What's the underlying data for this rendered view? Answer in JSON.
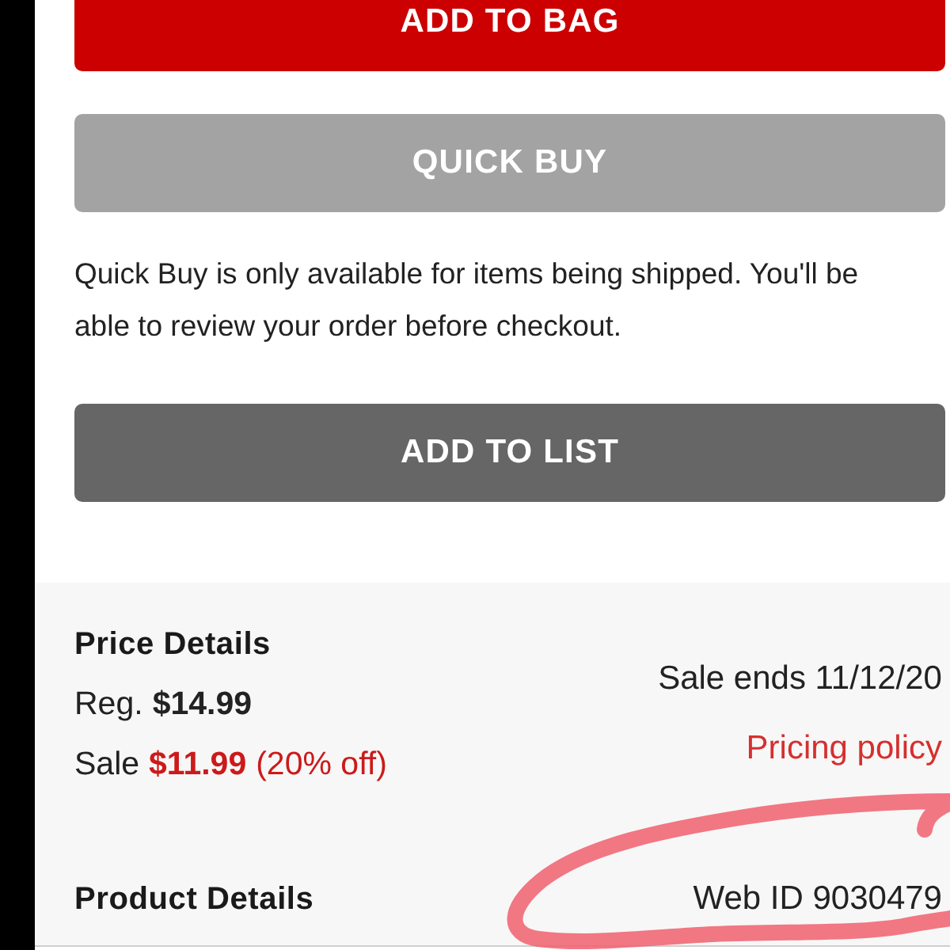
{
  "add_to_bag_button": {
    "label": "ADD TO BAG",
    "disabled": false
  },
  "quick_buy_button": {
    "label": "QUICK BUY",
    "disabled": true
  },
  "quick_buy_note": "Quick Buy is only available for items being shipped. You'll be able to review your order before checkout.",
  "add_to_list_button": {
    "label": "ADD TO LIST"
  },
  "price_details": {
    "title": "Price Details",
    "regular": {
      "label": "Reg.",
      "price": "$14.99"
    },
    "sale": {
      "label": "Sale",
      "price": "$11.99",
      "discount": "(20% off)"
    },
    "sale_ends": "Sale ends 11/12/20",
    "pricing_policy_link": "Pricing policy"
  },
  "product_details": {
    "title": "Product Details",
    "web_id": "Web ID 9030479"
  }
}
